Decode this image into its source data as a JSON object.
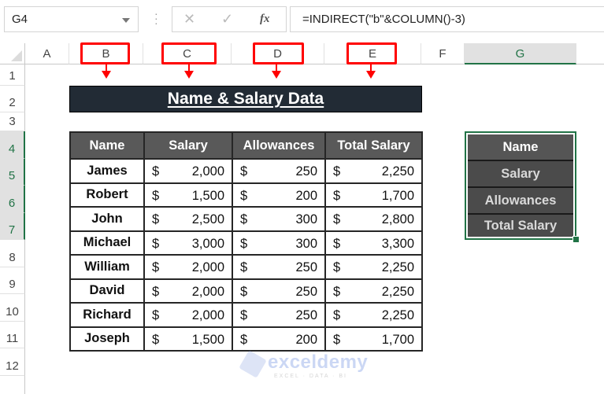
{
  "name_box": {
    "value": "G4"
  },
  "formula_bar": {
    "cancel_icon": "✕",
    "enter_icon": "✓",
    "fx_label": "fx",
    "formula": "=INDIRECT(\"b\"&COLUMN()-3)"
  },
  "columns": [
    "A",
    "B",
    "C",
    "D",
    "E",
    "F",
    "G"
  ],
  "selected_column": "G",
  "rows": [
    "1",
    "2",
    "3",
    "4",
    "5",
    "6",
    "7",
    "8",
    "9",
    "10",
    "11",
    "12"
  ],
  "selected_rows": [
    "4",
    "5",
    "6",
    "7"
  ],
  "highlighted_columns": [
    "B",
    "C",
    "D",
    "E"
  ],
  "title": "Name & Salary Data",
  "table": {
    "headers": [
      "Name",
      "Salary",
      "Allowances",
      "Total Salary"
    ],
    "currency": "$",
    "rows": [
      {
        "name": "James",
        "salary": "2,000",
        "allowances": "250",
        "total": "2,250"
      },
      {
        "name": "Robert",
        "salary": "1,500",
        "allowances": "200",
        "total": "1,700"
      },
      {
        "name": "John",
        "salary": "2,500",
        "allowances": "300",
        "total": "2,800"
      },
      {
        "name": "Michael",
        "salary": "3,000",
        "allowances": "300",
        "total": "3,300"
      },
      {
        "name": "William",
        "salary": "2,000",
        "allowances": "250",
        "total": "2,250"
      },
      {
        "name": "David",
        "salary": "2,000",
        "allowances": "250",
        "total": "2,250"
      },
      {
        "name": "Richard",
        "salary": "2,000",
        "allowances": "250",
        "total": "2,250"
      },
      {
        "name": "Joseph",
        "salary": "1,500",
        "allowances": "200",
        "total": "1,700"
      }
    ]
  },
  "result_column": [
    "Name",
    "Salary",
    "Allowances",
    "Total Salary"
  ],
  "watermark": {
    "brand": "exceldemy",
    "tagline": "EXCEL · DATA · BI"
  },
  "colors": {
    "accent_green": "#217346",
    "annotation_red": "#ff0000",
    "title_bg": "#222b35",
    "header_bg": "#595959"
  }
}
